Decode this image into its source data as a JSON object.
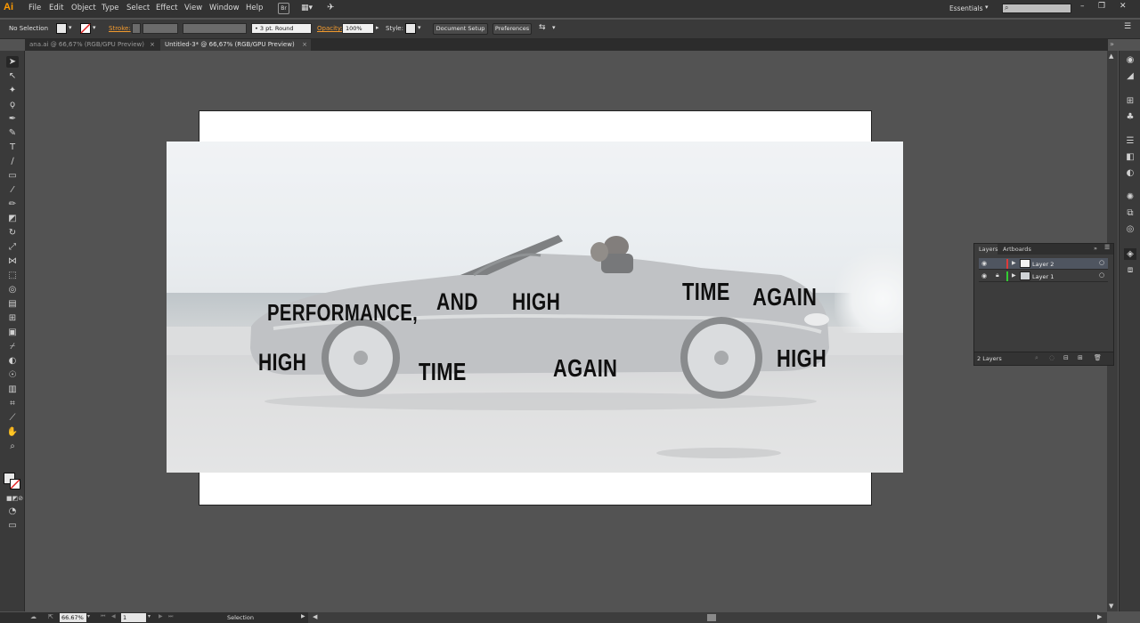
{
  "app": {
    "logo": "Ai"
  },
  "menu": [
    "File",
    "Edit",
    "Object",
    "Type",
    "Select",
    "Effect",
    "View",
    "Window",
    "Help"
  ],
  "menu_right": {
    "br_badge": "Br",
    "workspace": "Essentials",
    "search_placeholder": ""
  },
  "control": {
    "selection_label": "No Selection",
    "stroke_label": "Stroke:",
    "brush_value": "3 pt. Round",
    "opacity_label": "Opacity:",
    "opacity_value": "100%",
    "style_label": "Style:",
    "document_setup": "Document Setup",
    "preferences": "Preferences"
  },
  "tabs": [
    {
      "label": "ana.ai @ 66,67% (RGB/GPU Preview)",
      "active": false
    },
    {
      "label": "Untitled-3* @ 66,67% (RGB/GPU Preview)",
      "active": true
    }
  ],
  "artwork": {
    "words": [
      "PERFORMANCE,",
      "AND",
      "HIGH",
      "TIME",
      "AGAIN",
      "HIGH",
      "TIME",
      "AGAIN",
      "HIGH"
    ]
  },
  "layers_panel": {
    "tabs": [
      "Layers",
      "Artboards"
    ],
    "layers": [
      {
        "name": "Layer 2",
        "color": "#e03a3a",
        "selected": true
      },
      {
        "name": "Layer 1",
        "color": "#33cc33",
        "selected": false
      }
    ],
    "count_label": "2 Layers"
  },
  "status": {
    "zoom": "66.67%",
    "artboard": "1",
    "tool": "Selection"
  }
}
